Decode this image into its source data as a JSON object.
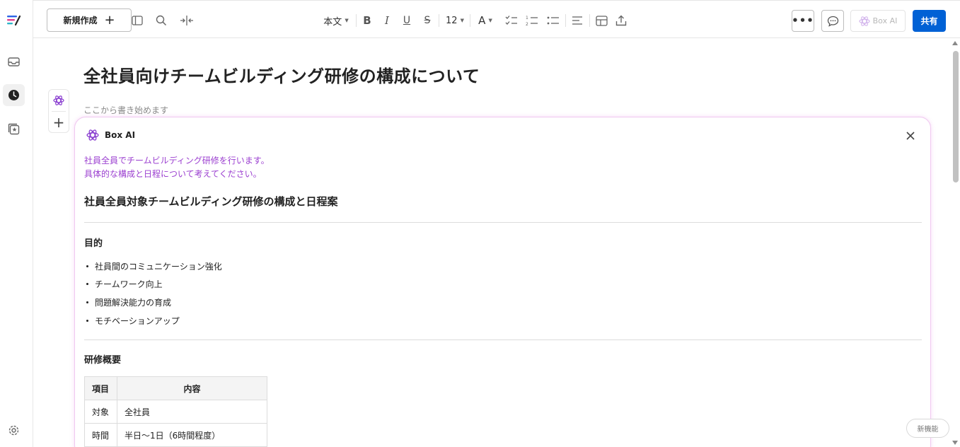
{
  "toolbar": {
    "new_button_label": "新規作成",
    "text_style": "本文",
    "font_size": "12",
    "box_ai_label": "Box AI",
    "share_label": "共有"
  },
  "document": {
    "title": "全社員向けチームビルディング研修の構成について",
    "placeholder": "ここから書き始めます"
  },
  "ai_panel": {
    "title": "Box AI",
    "prompt_lines": [
      "社員全員でチームビルディング研修を行います。",
      "具体的な構成と日程について考えてください。"
    ],
    "heading": "社員全員対象チームビルディング研修の構成と日程案",
    "section_purpose": "目的",
    "purpose_items": [
      "社員間のコミュニケーション強化",
      "チームワーク向上",
      "問題解決能力の育成",
      "モチベーションアップ"
    ],
    "section_overview": "研修概要",
    "table": {
      "headers": [
        "項目",
        "内容"
      ],
      "rows": [
        [
          "対象",
          "全社員"
        ],
        [
          "時間",
          "半日〜1日（6時間程度）"
        ]
      ]
    }
  },
  "new_feature_label": "新機能",
  "colors": {
    "accent": "#0061d5",
    "ai_prompt": "#9b3fd0",
    "ai_border": "#f0c8f0"
  }
}
